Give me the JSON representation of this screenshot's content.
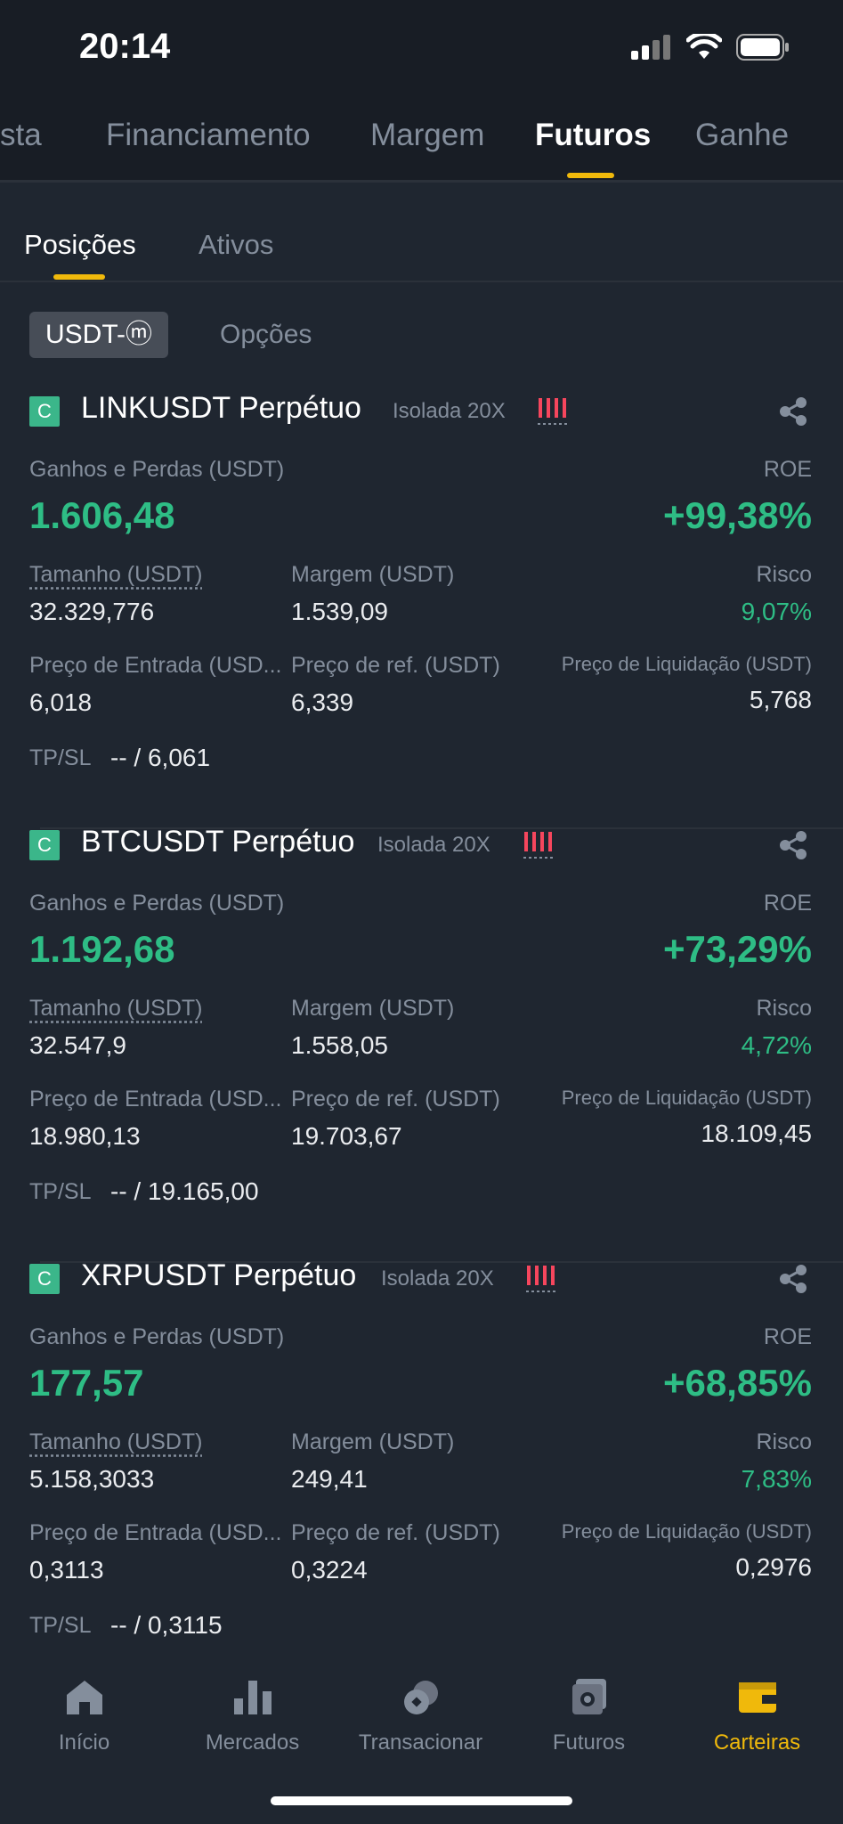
{
  "status_bar": {
    "time": "20:14"
  },
  "main_tabs": [
    {
      "label": "sta"
    },
    {
      "label": "Financiamento"
    },
    {
      "label": "Margem"
    },
    {
      "label": "Futuros"
    },
    {
      "label": "Ganhe"
    }
  ],
  "sub_tabs": [
    {
      "label": "Posições"
    },
    {
      "label": "Ativos"
    }
  ],
  "chips": [
    {
      "label": "USDT-ⓜ"
    },
    {
      "label": "Opções"
    }
  ],
  "labels": {
    "pnl": "Ganhos e Perdas (USDT)",
    "roe": "ROE",
    "size": "Tamanho (USDT)",
    "margin": "Margem (USDT)",
    "risk": "Risco",
    "entry": "Preço de Entrada (USD...",
    "mark": "Preço de ref. (USDT)",
    "liq": "Preço de Liquidação (USDT)",
    "tpsl": "TP/SL"
  },
  "positions": [
    {
      "badge": "C",
      "symbol": "LINKUSDT Perpétuo",
      "mode": "Isolada 20X",
      "pnl": "1.606,48",
      "roe": "+99,38%",
      "size": "32.329,776",
      "margin": "1.539,09",
      "risk": "9,07%",
      "entry": "6,018",
      "mark": "6,339",
      "liq": "5,768",
      "tpsl": "-- / 6,061",
      "risk_level": 4
    },
    {
      "badge": "C",
      "symbol": "BTCUSDT Perpétuo",
      "mode": "Isolada 20X",
      "pnl": "1.192,68",
      "roe": "+73,29%",
      "size": "32.547,9",
      "margin": "1.558,05",
      "risk": "4,72%",
      "entry": "18.980,13",
      "mark": "19.703,67",
      "liq": "18.109,45",
      "tpsl": "-- / 19.165,00",
      "risk_level": 4
    },
    {
      "badge": "C",
      "symbol": "XRPUSDT Perpétuo",
      "mode": "Isolada 20X",
      "pnl": "177,57",
      "roe": "+68,85%",
      "size": "5.158,3033",
      "margin": "249,41",
      "risk": "7,83%",
      "entry": "0,3113",
      "mark": "0,3224",
      "liq": "0,2976",
      "tpsl": "-- / 0,3115",
      "risk_level": 4
    }
  ],
  "bottom_nav": [
    {
      "label": "Início",
      "icon": "home-icon"
    },
    {
      "label": "Mercados",
      "icon": "bar-chart-icon"
    },
    {
      "label": "Transacionar",
      "icon": "trade-icon"
    },
    {
      "label": "Futuros",
      "icon": "futures-icon"
    },
    {
      "label": "Carteiras",
      "icon": "wallet-icon"
    }
  ],
  "colors": {
    "accent": "#f0b90b",
    "positive": "#2ebd85",
    "risk_bar": "#f6465d",
    "background": "#1f2630"
  }
}
